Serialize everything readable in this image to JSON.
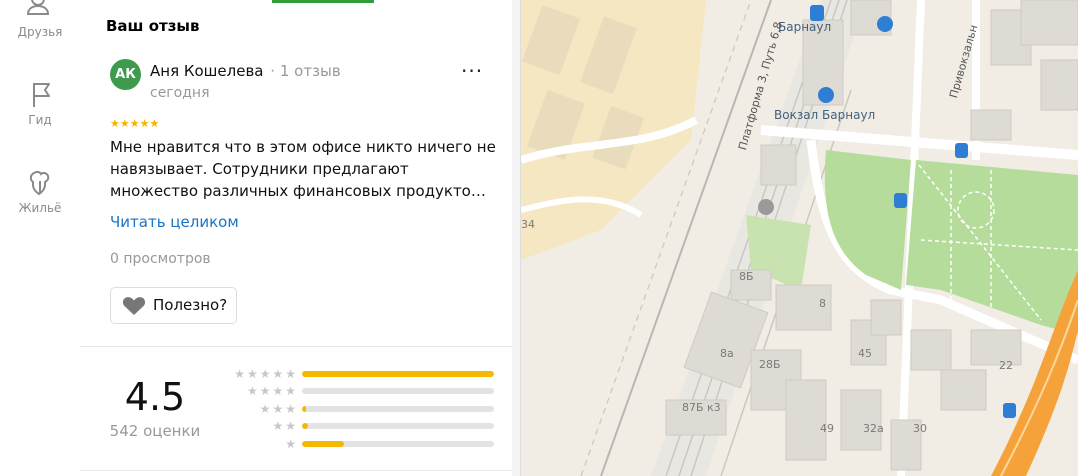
{
  "rail": {
    "items": [
      {
        "label": "Друзья",
        "icon": "friends-icon"
      },
      {
        "label": "Гид",
        "icon": "flag-icon"
      },
      {
        "label": "Жильё",
        "icon": "housing-icon"
      }
    ]
  },
  "review_section": {
    "title": "Ваш отзыв",
    "author": {
      "initials": "АК",
      "name": "Аня Кошелева",
      "reviews_count": "1 отзыв",
      "date": "сегодня",
      "avatar_color": "#3e9b4e"
    },
    "stars": "★★★★★",
    "text": "Мне нравится что в этом офисе никто ничего не навязывает. Сотрудники предлагают множество различных финансовых продукто…",
    "read_more": "Читать целиком",
    "views": "0 просмотров",
    "helpful_label": "Полезно?",
    "more_menu": "···"
  },
  "summary": {
    "rating": "4.5",
    "count_label": "542 оценки",
    "breakdown": [
      {
        "stars": "★★★★★",
        "fraction": 1.0
      },
      {
        "stars": "★★★★",
        "fraction": 0.0
      },
      {
        "stars": "★★★",
        "fraction": 0.02
      },
      {
        "stars": "★★",
        "fraction": 0.03
      },
      {
        "stars": "★",
        "fraction": 0.22
      }
    ],
    "accent_color": "#f5b800"
  },
  "map": {
    "places": [
      {
        "label": "Барнаул"
      },
      {
        "label": "Вокзал Барнаул"
      }
    ],
    "streets": [
      {
        "label": "Платформа 3, Путь 6,8"
      },
      {
        "label": "Привокзальн"
      }
    ],
    "house_numbers": [
      "34",
      "8Б",
      "8",
      "8а",
      "28Б",
      "87Б к3",
      "45",
      "49",
      "32а",
      "30",
      "22"
    ]
  }
}
